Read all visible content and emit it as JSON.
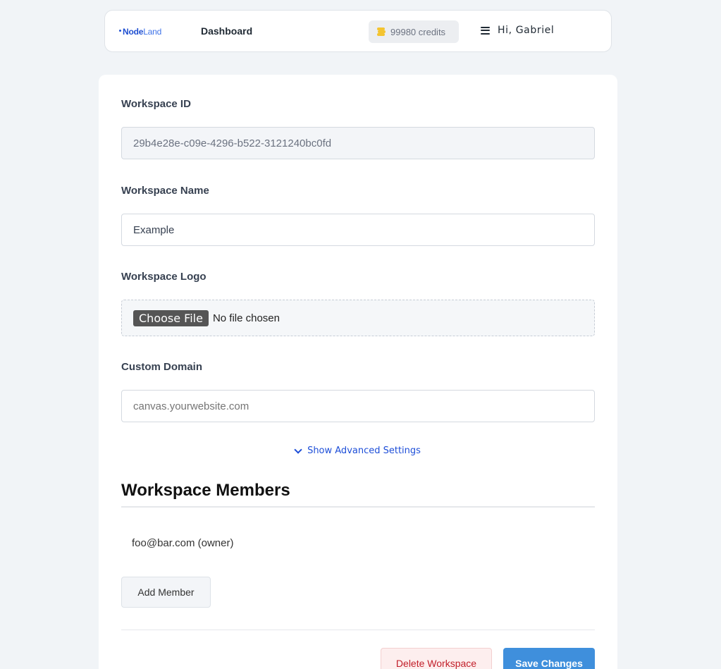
{
  "nav": {
    "logo_node": "Node",
    "logo_land": "Land",
    "dashboard": "Dashboard",
    "credits": "99980 credits",
    "greeting": "Hi, Gabriel"
  },
  "form": {
    "workspace_id_label": "Workspace ID",
    "workspace_id_value": "29b4e28e-c09e-4296-b522-3121240bc0fd",
    "workspace_name_label": "Workspace Name",
    "workspace_name_value": "Example",
    "workspace_logo_label": "Workspace Logo",
    "choose_file": "Choose File",
    "no_file": "No file chosen",
    "custom_domain_label": "Custom Domain",
    "custom_domain_placeholder": "canvas.yourwebsite.com",
    "advanced_settings": "Show Advanced Settings"
  },
  "members": {
    "title": "Workspace Members",
    "list": [
      "foo@bar.com (owner)"
    ],
    "add_button": "Add Member"
  },
  "actions": {
    "delete": "Delete Workspace",
    "save": "Save Changes"
  },
  "colors": {
    "brand": "#1f4fd1",
    "primary_button": "#3f8fdc",
    "danger_text": "#c2202b",
    "link": "#1d4ed8"
  }
}
